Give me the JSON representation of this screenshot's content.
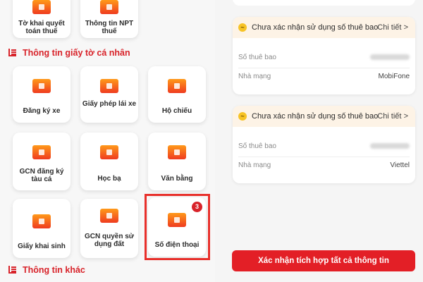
{
  "personal_section": {
    "title": "Thông tin giấy tờ cá nhân"
  },
  "other_section": {
    "title": "Thông tin khác"
  },
  "top_tiles": [
    {
      "label": "Tờ khai quyết toán thuế"
    },
    {
      "label": "Thông tin NPT thuế"
    }
  ],
  "tiles": [
    {
      "label": "Đăng ký xe"
    },
    {
      "label": "Giấy phép lái xe"
    },
    {
      "label": "Hộ chiếu"
    },
    {
      "label": "GCN đăng ký tàu cá"
    },
    {
      "label": "Học bạ"
    },
    {
      "label": "Văn bằng"
    },
    {
      "label": "Giấy khai sinh"
    },
    {
      "label": "GCN quyền sử dụng đất"
    },
    {
      "label": "Số điện thoại",
      "badge": "3"
    }
  ],
  "subscriber_cards": [
    {
      "status": "Chưa xác nhận sử dụng số thuê bao",
      "detail_link": "Chi tiết",
      "detail_chevron": ">",
      "number_label": "Số thuê bao",
      "carrier_label": "Nhà mạng",
      "carrier_value": "MobiFone"
    },
    {
      "status": "Chưa xác nhận sử dụng số thuê bao",
      "detail_link": "Chi tiết",
      "detail_chevron": ">",
      "number_label": "Số thuê bao",
      "carrier_label": "Nhà mạng",
      "carrier_value": "Viettel"
    }
  ],
  "confirm_button": {
    "label": "Xác nhận tích hợp tất cả thông tin"
  },
  "colors": {
    "accent": "#d8232a",
    "button": "#e31f26",
    "warn_bg": "#fdf3e6",
    "warn_icon": "#f7c325"
  }
}
